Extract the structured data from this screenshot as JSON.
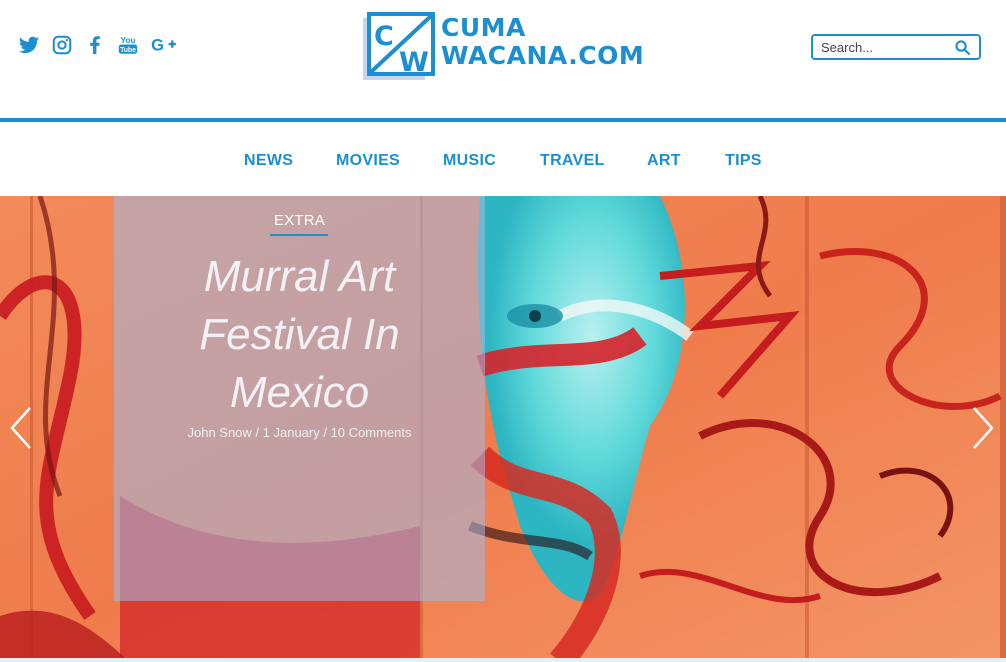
{
  "header": {
    "social": [
      {
        "icon": "twitter-icon"
      },
      {
        "icon": "instagram-icon"
      },
      {
        "icon": "facebook-icon"
      },
      {
        "icon": "youtube-icon",
        "text": "You Tube"
      },
      {
        "icon": "google-plus-icon",
        "text": "G+"
      }
    ],
    "logo": {
      "mark_letters": [
        "C",
        "W"
      ],
      "line1": "CUMA",
      "line2": "WACANA.COM"
    },
    "search": {
      "placeholder": "Search...",
      "icon": "search-icon"
    }
  },
  "nav": {
    "items": [
      "NEWS",
      "MOVIES",
      "MUSIC",
      "TRAVEL",
      "ART",
      "TIPS"
    ]
  },
  "hero": {
    "category": "EXTRA",
    "title_lines": [
      "Murral Art",
      "Festival In",
      "Mexico"
    ],
    "meta": "John Snow / 1 January / 10 Comments",
    "prev_icon": "chevron-left-icon",
    "next_icon": "chevron-right-icon"
  },
  "colors": {
    "accent": "#1b8fd1",
    "panel_overlay": "#a0b9e6"
  }
}
